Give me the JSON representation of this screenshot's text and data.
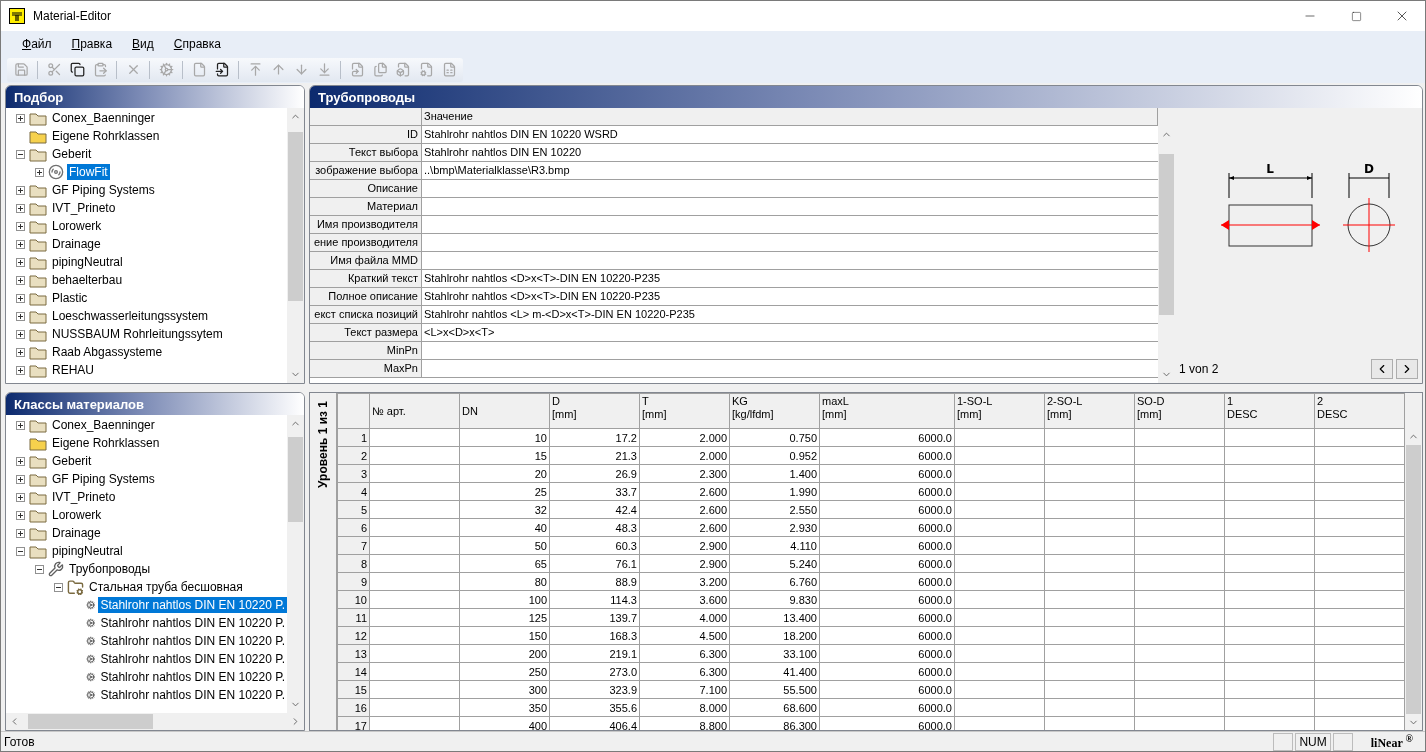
{
  "window": {
    "title": "Material-Editor"
  },
  "menu": [
    "Файл",
    "Правка",
    "Вид",
    "Справка"
  ],
  "toolbar": [
    {
      "kind": "save",
      "disabled": true
    },
    {
      "kind": "separator"
    },
    {
      "kind": "cut",
      "disabled": true
    },
    {
      "kind": "copy",
      "disabled": false
    },
    {
      "kind": "paste",
      "disabled": true
    },
    {
      "kind": "separator"
    },
    {
      "kind": "delete",
      "disabled": true
    },
    {
      "kind": "separator"
    },
    {
      "kind": "gears",
      "disabled": true
    },
    {
      "kind": "separator"
    },
    {
      "kind": "page",
      "disabled": true
    },
    {
      "kind": "page-redo",
      "disabled": false
    },
    {
      "kind": "separator"
    },
    {
      "kind": "move-top",
      "disabled": true
    },
    {
      "kind": "move-up",
      "disabled": true
    },
    {
      "kind": "move-down",
      "disabled": true
    },
    {
      "kind": "move-bottom",
      "disabled": true
    },
    {
      "kind": "separator"
    },
    {
      "kind": "doc-arrow",
      "disabled": true
    },
    {
      "kind": "doc-copy",
      "disabled": true
    },
    {
      "kind": "doc-folder",
      "disabled": true
    },
    {
      "kind": "doc-gear",
      "disabled": true
    },
    {
      "kind": "doc-table",
      "disabled": true
    }
  ],
  "selection_panel": {
    "title": "Подбор",
    "tree": [
      {
        "label": "Conex_Baenninger",
        "kind": "folder",
        "expanded": false,
        "selected": false
      },
      {
        "label": "Eigene Rohrklassen",
        "kind": "folder-yellow",
        "selected": false
      },
      {
        "label": "Geberit",
        "kind": "folder",
        "expanded": true,
        "selected": false,
        "children": [
          {
            "label": "FlowFit",
            "kind": "fitting",
            "expanded": false,
            "selected": true
          }
        ]
      },
      {
        "label": "GF Piping Systems",
        "kind": "folder",
        "expanded": false,
        "selected": false
      },
      {
        "label": "IVT_Prineto",
        "kind": "folder",
        "expanded": false,
        "selected": false
      },
      {
        "label": "Lorowerk",
        "kind": "folder",
        "expanded": false,
        "selected": false
      },
      {
        "label": "Drainage",
        "kind": "folder",
        "expanded": false,
        "selected": false
      },
      {
        "label": "pipingNeutral",
        "kind": "folder",
        "expanded": false,
        "selected": false
      },
      {
        "label": "behaelterbau",
        "kind": "folder",
        "expanded": false,
        "selected": false
      },
      {
        "label": "Plastic",
        "kind": "folder",
        "expanded": false,
        "selected": false
      },
      {
        "label": "Loeschwasserleitungssystem",
        "kind": "folder",
        "expanded": false,
        "selected": false
      },
      {
        "label": "NUSSBAUM Rohrleitungssytem",
        "kind": "folder",
        "expanded": false,
        "selected": false
      },
      {
        "label": "Raab Abgassysteme",
        "kind": "folder",
        "expanded": false,
        "selected": false
      },
      {
        "label": "REHAU",
        "kind": "folder",
        "expanded": false,
        "selected": false
      }
    ]
  },
  "classes_panel": {
    "title": "Классы материалов",
    "tree": [
      {
        "label": "Conex_Baenninger",
        "kind": "folder",
        "expanded": false,
        "selected": false
      },
      {
        "label": "Eigene Rohrklassen",
        "kind": "folder-yellow",
        "selected": false
      },
      {
        "label": "Geberit",
        "kind": "folder",
        "expanded": false,
        "selected": false
      },
      {
        "label": "GF Piping Systems",
        "kind": "folder",
        "expanded": false,
        "selected": false
      },
      {
        "label": "IVT_Prineto",
        "kind": "folder",
        "expanded": false,
        "selected": false
      },
      {
        "label": "Lorowerk",
        "kind": "folder",
        "expanded": false,
        "selected": false
      },
      {
        "label": "Drainage",
        "kind": "folder",
        "expanded": false,
        "selected": false
      },
      {
        "label": "pipingNeutral",
        "kind": "folder",
        "expanded": true,
        "selected": false,
        "children": [
          {
            "label": "Трубопроводы",
            "kind": "pipes",
            "expanded": true,
            "selected": false,
            "children": [
              {
                "label": "Стальная труба бесшовная",
                "kind": "folder-gear",
                "expanded": true,
                "selected": false,
                "children": [
                  {
                    "label": "Stahlrohr nahtlos DIN EN 10220 P.",
                    "kind": "gears",
                    "selected": true
                  },
                  {
                    "label": "Stahlrohr nahtlos DIN EN 10220 P.",
                    "kind": "gears",
                    "selected": false
                  },
                  {
                    "label": "Stahlrohr nahtlos DIN EN 10220 P.",
                    "kind": "gears",
                    "selected": false
                  },
                  {
                    "label": "Stahlrohr nahtlos DIN EN 10220 P.",
                    "kind": "gears",
                    "selected": false
                  },
                  {
                    "label": "Stahlrohr nahtlos DIN EN 10220 P.",
                    "kind": "gears",
                    "selected": false
                  },
                  {
                    "label": "Stahlrohr nahtlos DIN EN 10220 P.",
                    "kind": "gears",
                    "selected": false
                  }
                ]
              }
            ]
          }
        ]
      }
    ]
  },
  "properties_panel": {
    "title": "Трубопроводы",
    "value_header": "Значение",
    "rows": [
      {
        "label": "ID",
        "value": "Stahlrohr nahtlos DIN EN 10220 WSRD"
      },
      {
        "label": "Текст выбора",
        "value": "Stahlrohr nahtlos DIN EN 10220"
      },
      {
        "label": "зображение выбора",
        "value": "..\\bmp\\Materialklasse\\R3.bmp"
      },
      {
        "label": "Описание"
      },
      {
        "label": "Материал"
      },
      {
        "label": "Имя производителя"
      },
      {
        "label": "ение производителя"
      },
      {
        "label": "Имя файла MMD"
      },
      {
        "label": "Краткий текст",
        "value": "Stahlrohr nahtlos <D>x<T>-DIN EN 10220-P235"
      },
      {
        "label": "Полное описание",
        "value": "Stahlrohr nahtlos <D>x<T>-DIN EN 10220-P235"
      },
      {
        "label": "екст списка позиций",
        "value": "Stahlrohr nahtlos <L> m-<D>x<T>-DIN EN 10220-P235"
      },
      {
        "label": "Текст размера",
        "value": "<L>x<D>x<T>"
      },
      {
        "label": "MinPn"
      },
      {
        "label": "MaxPn"
      }
    ],
    "preview": {
      "length_label": "L",
      "diameter_label": "D",
      "page": "1 von 2"
    }
  },
  "table": {
    "level_label": "Уровень 1 из 1",
    "columns": [
      {
        "label": "№ арт."
      },
      {
        "label": "DN"
      },
      {
        "label": "D",
        "sub": "[mm]"
      },
      {
        "label": "T",
        "sub": "[mm]"
      },
      {
        "label": "KG",
        "sub": "[kg/lfdm]"
      },
      {
        "label": "maxL",
        "sub": "[mm]"
      },
      {
        "label": "1-SO-L",
        "sub": "[mm]"
      },
      {
        "label": "2-SO-L",
        "sub": "[mm]"
      },
      {
        "label": "SO-D",
        "sub": "[mm]"
      },
      {
        "label": "1",
        "sub": "DESC"
      },
      {
        "label": "2",
        "sub": "DESC"
      }
    ],
    "rows": [
      {
        "number": "1",
        "dn": "10",
        "d": "17.2",
        "t": "2.000",
        "kg": "0.750",
        "max_l": "6000.0"
      },
      {
        "number": "2",
        "dn": "15",
        "d": "21.3",
        "t": "2.000",
        "kg": "0.952",
        "max_l": "6000.0"
      },
      {
        "number": "3",
        "dn": "20",
        "d": "26.9",
        "t": "2.300",
        "kg": "1.400",
        "max_l": "6000.0"
      },
      {
        "number": "4",
        "dn": "25",
        "d": "33.7",
        "t": "2.600",
        "kg": "1.990",
        "max_l": "6000.0"
      },
      {
        "number": "5",
        "dn": "32",
        "d": "42.4",
        "t": "2.600",
        "kg": "2.550",
        "max_l": "6000.0"
      },
      {
        "number": "6",
        "dn": "40",
        "d": "48.3",
        "t": "2.600",
        "kg": "2.930",
        "max_l": "6000.0"
      },
      {
        "number": "7",
        "dn": "50",
        "d": "60.3",
        "t": "2.900",
        "kg": "4.110",
        "max_l": "6000.0"
      },
      {
        "number": "8",
        "dn": "65",
        "d": "76.1",
        "t": "2.900",
        "kg": "5.240",
        "max_l": "6000.0"
      },
      {
        "number": "9",
        "dn": "80",
        "d": "88.9",
        "t": "3.200",
        "kg": "6.760",
        "max_l": "6000.0"
      },
      {
        "number": "10",
        "dn": "100",
        "d": "114.3",
        "t": "3.600",
        "kg": "9.830",
        "max_l": "6000.0"
      },
      {
        "number": "11",
        "dn": "125",
        "d": "139.7",
        "t": "4.000",
        "kg": "13.400",
        "max_l": "6000.0"
      },
      {
        "number": "12",
        "dn": "150",
        "d": "168.3",
        "t": "4.500",
        "kg": "18.200",
        "max_l": "6000.0"
      },
      {
        "number": "13",
        "dn": "200",
        "d": "219.1",
        "t": "6.300",
        "kg": "33.100",
        "max_l": "6000.0"
      },
      {
        "number": "14",
        "dn": "250",
        "d": "273.0",
        "t": "6.300",
        "kg": "41.400",
        "max_l": "6000.0"
      },
      {
        "number": "15",
        "dn": "300",
        "d": "323.9",
        "t": "7.100",
        "kg": "55.500",
        "max_l": "6000.0"
      },
      {
        "number": "16",
        "dn": "350",
        "d": "355.6",
        "t": "8.000",
        "kg": "68.600",
        "max_l": "6000.0"
      },
      {
        "number": "17",
        "dn": "400",
        "d": "406.4",
        "t": "8.800",
        "kg": "86.300",
        "max_l": "6000.0"
      }
    ]
  },
  "status_bar": {
    "text": "Готов",
    "num": "NUM",
    "logo": "liNear $^{®}$"
  }
}
